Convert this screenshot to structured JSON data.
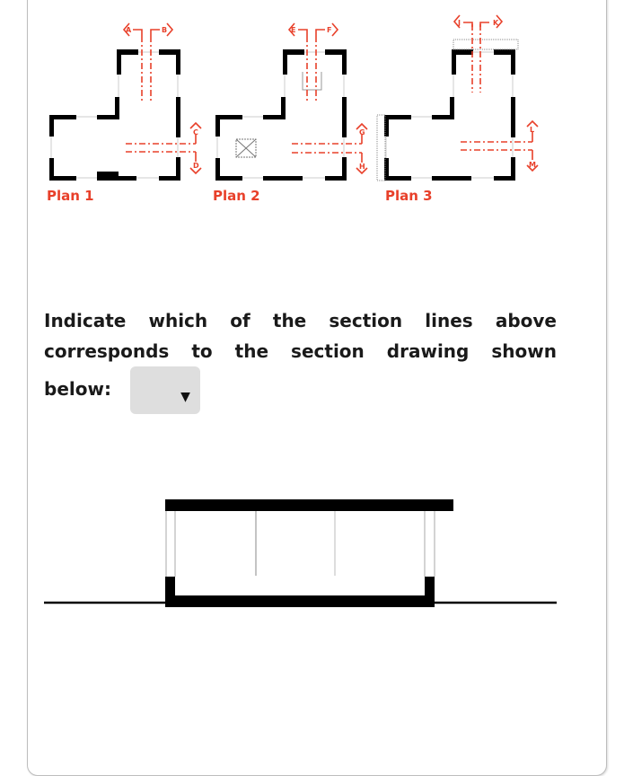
{
  "plans": [
    {
      "label": "Plan 1",
      "section_markers": [
        "A",
        "B",
        "C",
        "D"
      ]
    },
    {
      "label": "Plan 2",
      "section_markers": [
        "E",
        "F",
        "G",
        "H"
      ]
    },
    {
      "label": "Plan 3",
      "section_markers": [
        "J",
        "K",
        "L",
        "M"
      ]
    }
  ],
  "question": {
    "text": "Indicate which of the section lines above corresponds to the section drawing shown below:",
    "answer_select": {
      "selected": "",
      "arrow_icon": "▼"
    }
  },
  "colors": {
    "accent_red": "#e8402a",
    "wall": "#000000",
    "select_bg": "#dedede"
  }
}
